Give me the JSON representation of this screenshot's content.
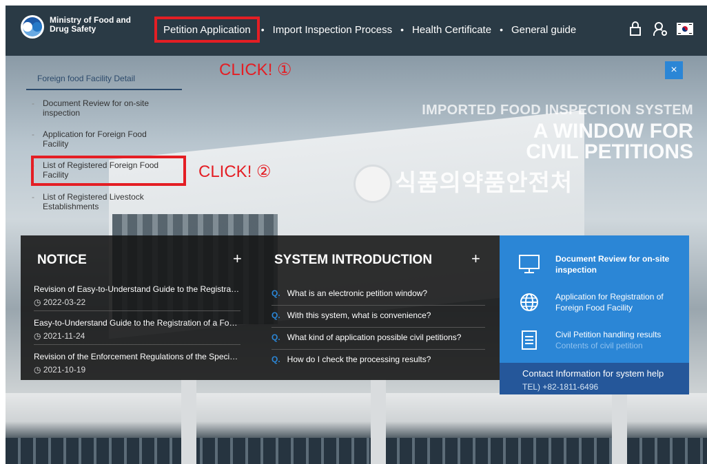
{
  "header": {
    "logo_text_line1": "Ministry of Food and",
    "logo_text_line2": "Drug Safety",
    "nav": [
      {
        "label": "Petition Application"
      },
      {
        "label": "Import Inspection Process"
      },
      {
        "label": "Health Certificate"
      },
      {
        "label": "General guide"
      }
    ],
    "icons": [
      "lock-icon",
      "user-icon",
      "korean-flag-icon"
    ]
  },
  "annotations": {
    "click1": "CLICK! ①",
    "click2": "CLICK! ②",
    "highlight_color": "#e41e24"
  },
  "menu": {
    "heading": "Foreign food Facility Detail",
    "items": [
      {
        "label": "Document Review for on-site inspection"
      },
      {
        "label": "Application for Foreign Food Facility"
      },
      {
        "label": "List of Registered Foreign Food Facility"
      },
      {
        "label": "List of Registered Livestock Establishments"
      }
    ]
  },
  "hero": {
    "subtitle": "IMPORTED FOOD INSPECTION SYSTEM",
    "title_line1": "A WINDOW FOR",
    "title_line2": "CIVIL PETITIONS",
    "building_sign": "식품의약품안전처",
    "close_label": "×"
  },
  "notice": {
    "title": "NOTICE",
    "more": "+",
    "items": [
      {
        "title": "Revision of Easy-to-Understand Guide to the Registra…",
        "date": "2022-03-22"
      },
      {
        "title": "Easy-to-Understand Guide to the Registration of a Fo…",
        "date": "2021-11-24"
      },
      {
        "title": "Revision of the Enforcement Regulations of the Speci…",
        "date": "2021-10-19"
      }
    ]
  },
  "system": {
    "title": "SYSTEM INTRODUCTION",
    "more": "+",
    "q_mark": "Q.",
    "items": [
      {
        "text": "What is an electronic petition window?"
      },
      {
        "text": "With this system, what is convenience?"
      },
      {
        "text": "What kind of application possible civil petitions?"
      },
      {
        "text": "How do I check the processing results?"
      }
    ]
  },
  "services": [
    {
      "icon": "monitor-icon",
      "title": "Document Review for on-site inspection",
      "sub": ""
    },
    {
      "icon": "globe-icon",
      "title": "Application for Registration of Foreign Food Facility",
      "sub": ""
    },
    {
      "icon": "document-icon",
      "title": "Civil Petition handling results",
      "sub": "Contents of civil petition"
    }
  ],
  "contact": {
    "title": "Contact Information for system help",
    "tel": "TEL) +82-1811-6496"
  },
  "colors": {
    "header_bg": "#2a3a45",
    "accent_blue": "#2b86d6",
    "dark_panel": "#141414",
    "highlight_red": "#e41e24"
  }
}
